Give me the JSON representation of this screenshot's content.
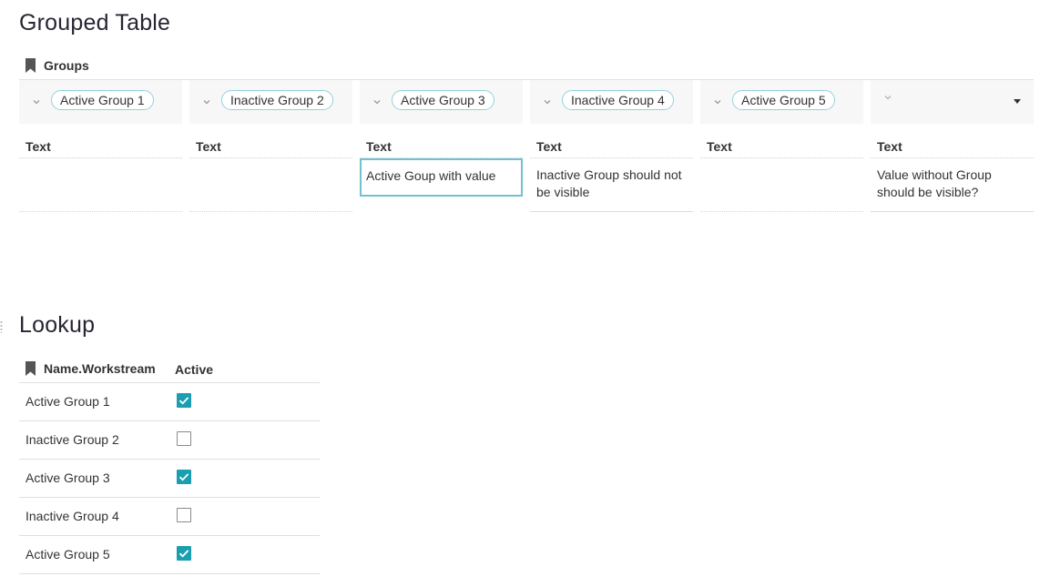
{
  "grouped_table": {
    "title": "Grouped Table",
    "section_label": "Groups",
    "columns": [
      {
        "group": "Active Group 1",
        "header": "Text",
        "value": ""
      },
      {
        "group": "Inactive Group 2",
        "header": "Text",
        "value": ""
      },
      {
        "group": "Active Group 3",
        "header": "Text",
        "value": "Active Goup with value"
      },
      {
        "group": "Inactive Group 4",
        "header": "Text",
        "value": "Inactive Group should not be visible"
      },
      {
        "group": "Active Group 5",
        "header": "Text",
        "value": ""
      },
      {
        "group": "",
        "header": "Text",
        "value": "Value without Group should be visible?"
      }
    ]
  },
  "lookup": {
    "title": "Lookup",
    "headers": {
      "name": "Name.Workstream",
      "active": "Active"
    },
    "rows": [
      {
        "name": "Active Group 1",
        "active": true
      },
      {
        "name": "Inactive Group 2",
        "active": false
      },
      {
        "name": "Active Group 3",
        "active": true
      },
      {
        "name": "Inactive Group 4",
        "active": false
      },
      {
        "name": "Active Group 5",
        "active": true
      }
    ]
  },
  "colors": {
    "accent": "#1a9fb0",
    "pill_border": "#93d2db",
    "selection": "#72c1cf"
  },
  "icons": [
    "bookmark-icon",
    "chevron-down-icon",
    "caret-down-icon",
    "checkbox-checked-icon",
    "checkbox-unchecked-icon"
  ]
}
